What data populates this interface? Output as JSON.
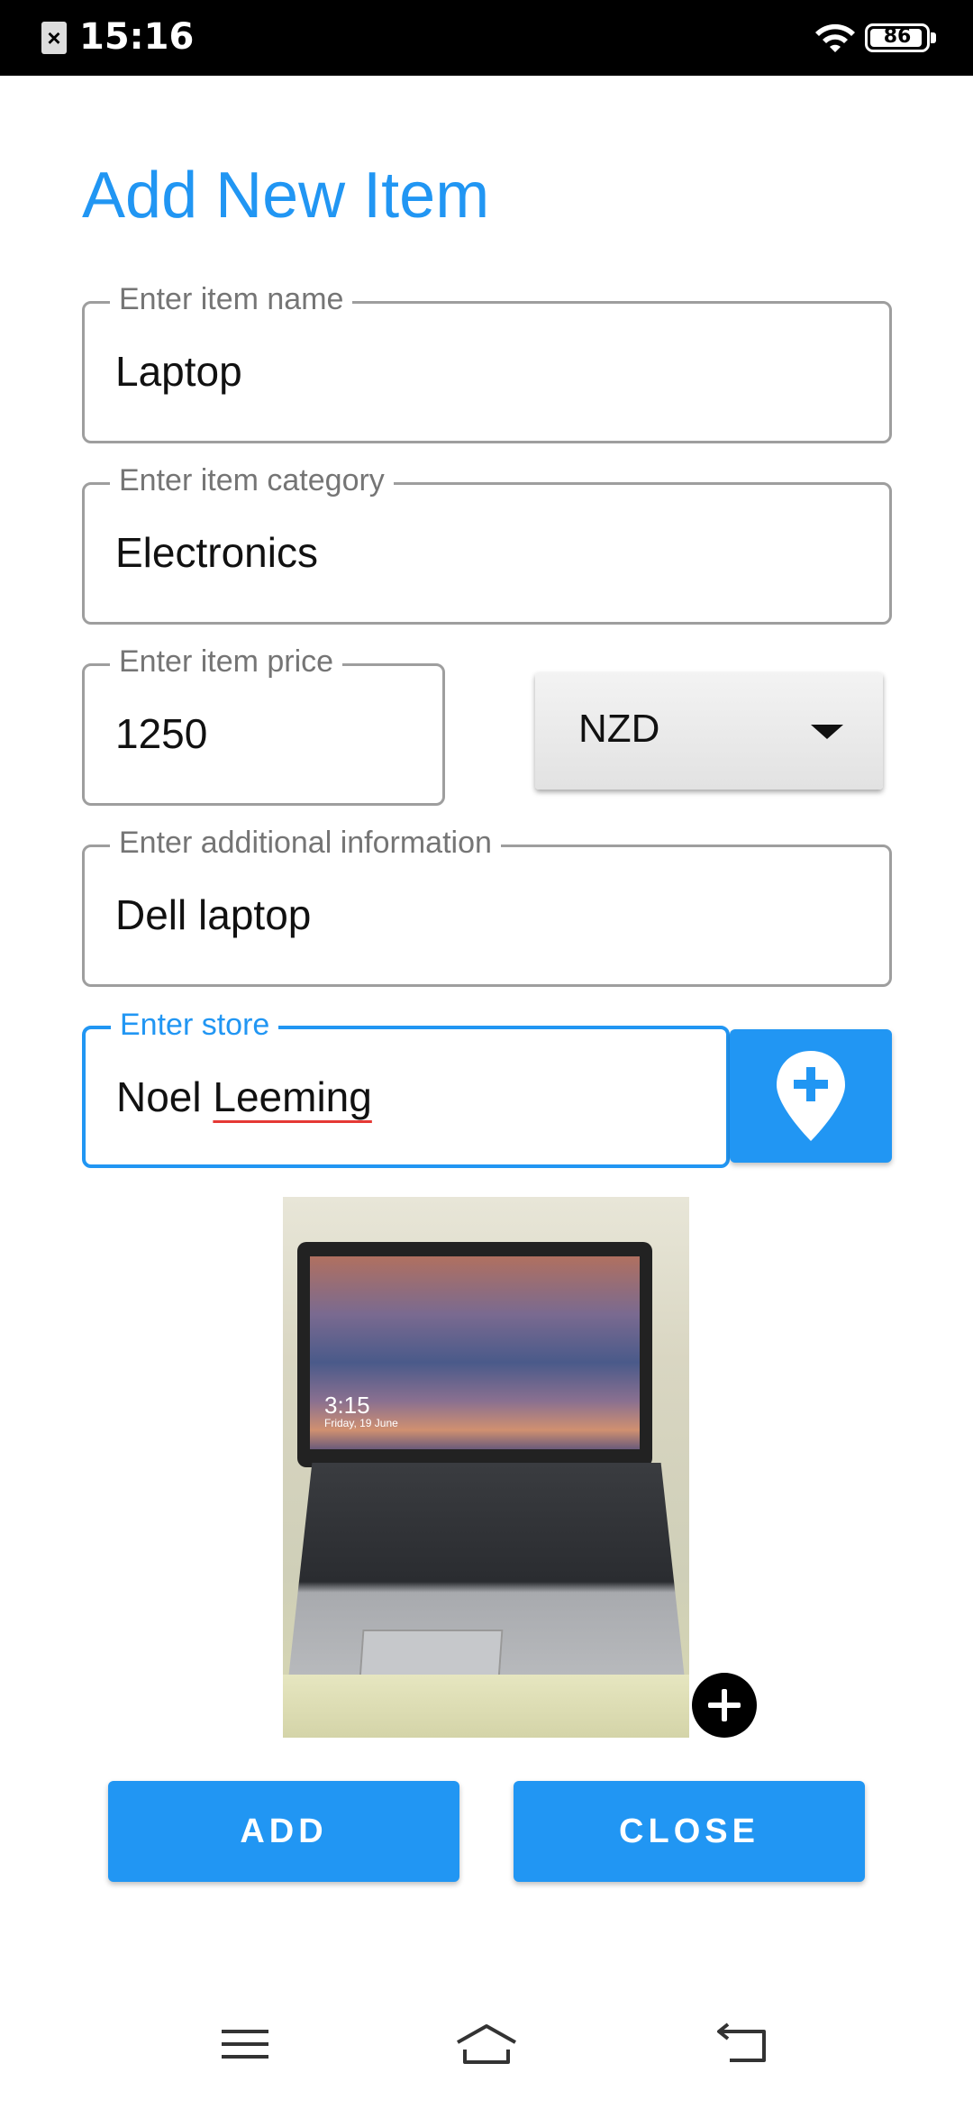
{
  "status_bar": {
    "time": "15:16",
    "battery_level": "86"
  },
  "page": {
    "title": "Add New Item"
  },
  "form": {
    "item_name": {
      "label": "Enter item name",
      "value": "Laptop"
    },
    "item_category": {
      "label": "Enter item category",
      "value": "Electronics"
    },
    "item_price": {
      "label": "Enter item price",
      "value": "1250"
    },
    "currency": {
      "selected": "NZD"
    },
    "additional_info": {
      "label": "Enter additional information",
      "value": "Dell laptop"
    },
    "store": {
      "label": "Enter store",
      "value_first": "Noel",
      "value_second": "Leeming"
    }
  },
  "photo": {
    "screen_time": "3:15",
    "screen_date": "Friday, 19 June"
  },
  "buttons": {
    "add_label": "ADD",
    "close_label": "CLOSE"
  },
  "colors": {
    "accent": "#2196f3",
    "border": "#9e9e9e",
    "spell_error": "#e53935"
  },
  "icons": [
    "sim-icon",
    "wifi-icon",
    "battery-icon",
    "add-location-icon",
    "add-photo-icon",
    "menu-icon",
    "home-icon",
    "back-icon"
  ]
}
